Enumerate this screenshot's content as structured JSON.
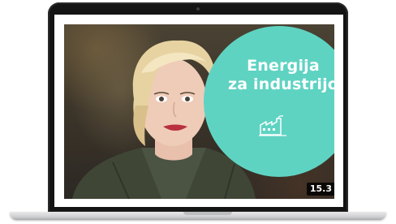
{
  "video": {
    "headline": "Energija za industrijo",
    "headline_line1": "Energija",
    "headline_line2": "za industrijo",
    "icon": "factory-icon",
    "duration": "15.3"
  },
  "colors": {
    "accent_teal": "#5fd3c2",
    "laptop_bezel": "#141414",
    "text_on_accent": "#ffffff"
  }
}
